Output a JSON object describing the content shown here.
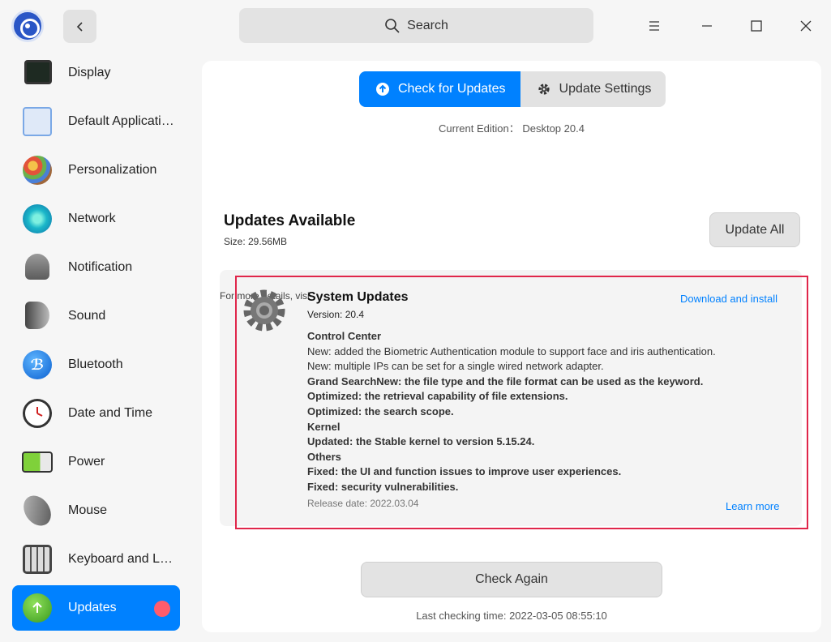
{
  "search": {
    "label": "Search"
  },
  "sidebar": {
    "items": [
      {
        "label": "Display",
        "icon": "display-icon"
      },
      {
        "label": "Default Applications",
        "icon": "default-apps-icon"
      },
      {
        "label": "Personalization",
        "icon": "personalization-icon"
      },
      {
        "label": "Network",
        "icon": "network-icon"
      },
      {
        "label": "Notification",
        "icon": "bell-icon"
      },
      {
        "label": "Sound",
        "icon": "speaker-icon"
      },
      {
        "label": "Bluetooth",
        "icon": "bluetooth-icon"
      },
      {
        "label": "Date and Time",
        "icon": "clock-icon"
      },
      {
        "label": "Power",
        "icon": "battery-icon"
      },
      {
        "label": "Mouse",
        "icon": "mouse-icon"
      },
      {
        "label": "Keyboard and Language",
        "icon": "keyboard-icon"
      },
      {
        "label": "Updates",
        "icon": "update-icon",
        "active": true
      }
    ]
  },
  "tabs": {
    "check": "Check for Updates",
    "settings": "Update Settings"
  },
  "edition": "Current Edition： Desktop 20.4",
  "updates": {
    "title": "Updates Available",
    "size": "Size: 29.56MB",
    "update_all": "Update All"
  },
  "card": {
    "overlap_text": "For more details, visit",
    "title": "System Updates",
    "version": "Version: 20.4",
    "notes": [
      {
        "text": "Control Center",
        "bold": true
      },
      {
        "text": "New: added the Biometric Authentication module to support face and iris authentication.",
        "bold": false
      },
      {
        "text": "New: multiple IPs can be set for a single wired network adapter.",
        "bold": false
      },
      {
        "text": "Grand SearchNew: the file type and the file format can be used as the keyword.",
        "bold": true
      },
      {
        "text": "Optimized: the retrieval capability of file extensions.",
        "bold": true
      },
      {
        "text": "Optimized: the search scope.",
        "bold": true
      },
      {
        "text": "Kernel",
        "bold": true
      },
      {
        "text": "Updated: the Stable kernel to version 5.15.24.",
        "bold": true
      },
      {
        "text": "Others",
        "bold": true
      },
      {
        "text": "Fixed: the UI and function issues to improve user experiences.",
        "bold": true
      },
      {
        "text": "Fixed: security vulnerabilities.",
        "bold": true
      }
    ],
    "release": "Release date: 2022.03.04",
    "download": "Download and install",
    "learn_more": "Learn more"
  },
  "footer": {
    "check_again": "Check Again",
    "last_checking": "Last checking time: 2022-03-05 08:55:10"
  },
  "colors": {
    "accent": "#0081ff",
    "highlight": "#e0264a",
    "badge": "#ff5c6c"
  }
}
